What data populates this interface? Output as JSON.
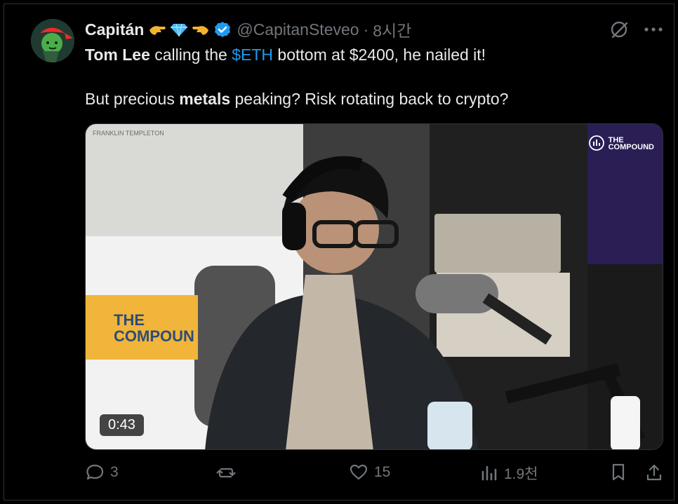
{
  "tweet": {
    "author": {
      "display_name": "Capitán",
      "emojis": [
        "hand-left-emoji",
        "gem-emoji",
        "hand-right-emoji"
      ],
      "verified_icon": "verified-badge-icon",
      "handle": "@CapitanSteveo",
      "separator": "·",
      "time": "8시간"
    },
    "text": {
      "line1": {
        "bold_name": "Tom Lee",
        "text1": " calling the ",
        "cashtag": "$ETH",
        "text2": " bottom at $2400, he nailed it!"
      },
      "line2": {
        "text1": "But precious ",
        "bold_word": "metals",
        "text2": " peaking? Risk rotating back to crypto?"
      }
    },
    "media": {
      "duration": "0:43",
      "brand_left": "FRANKLIN TEMPLETON",
      "brand_right_1": "THE",
      "brand_right_2": "COMPOUND",
      "sign_1": "THE",
      "sign_2": "COMPOUN"
    },
    "actions": {
      "reply_count": "3",
      "like_count": "15",
      "views_count": "1.9천"
    }
  },
  "colors": {
    "background": "#000000",
    "text": "#e7e9ea",
    "muted": "#71767b",
    "accent": "#1d9bf0",
    "border": "#2f3336"
  }
}
